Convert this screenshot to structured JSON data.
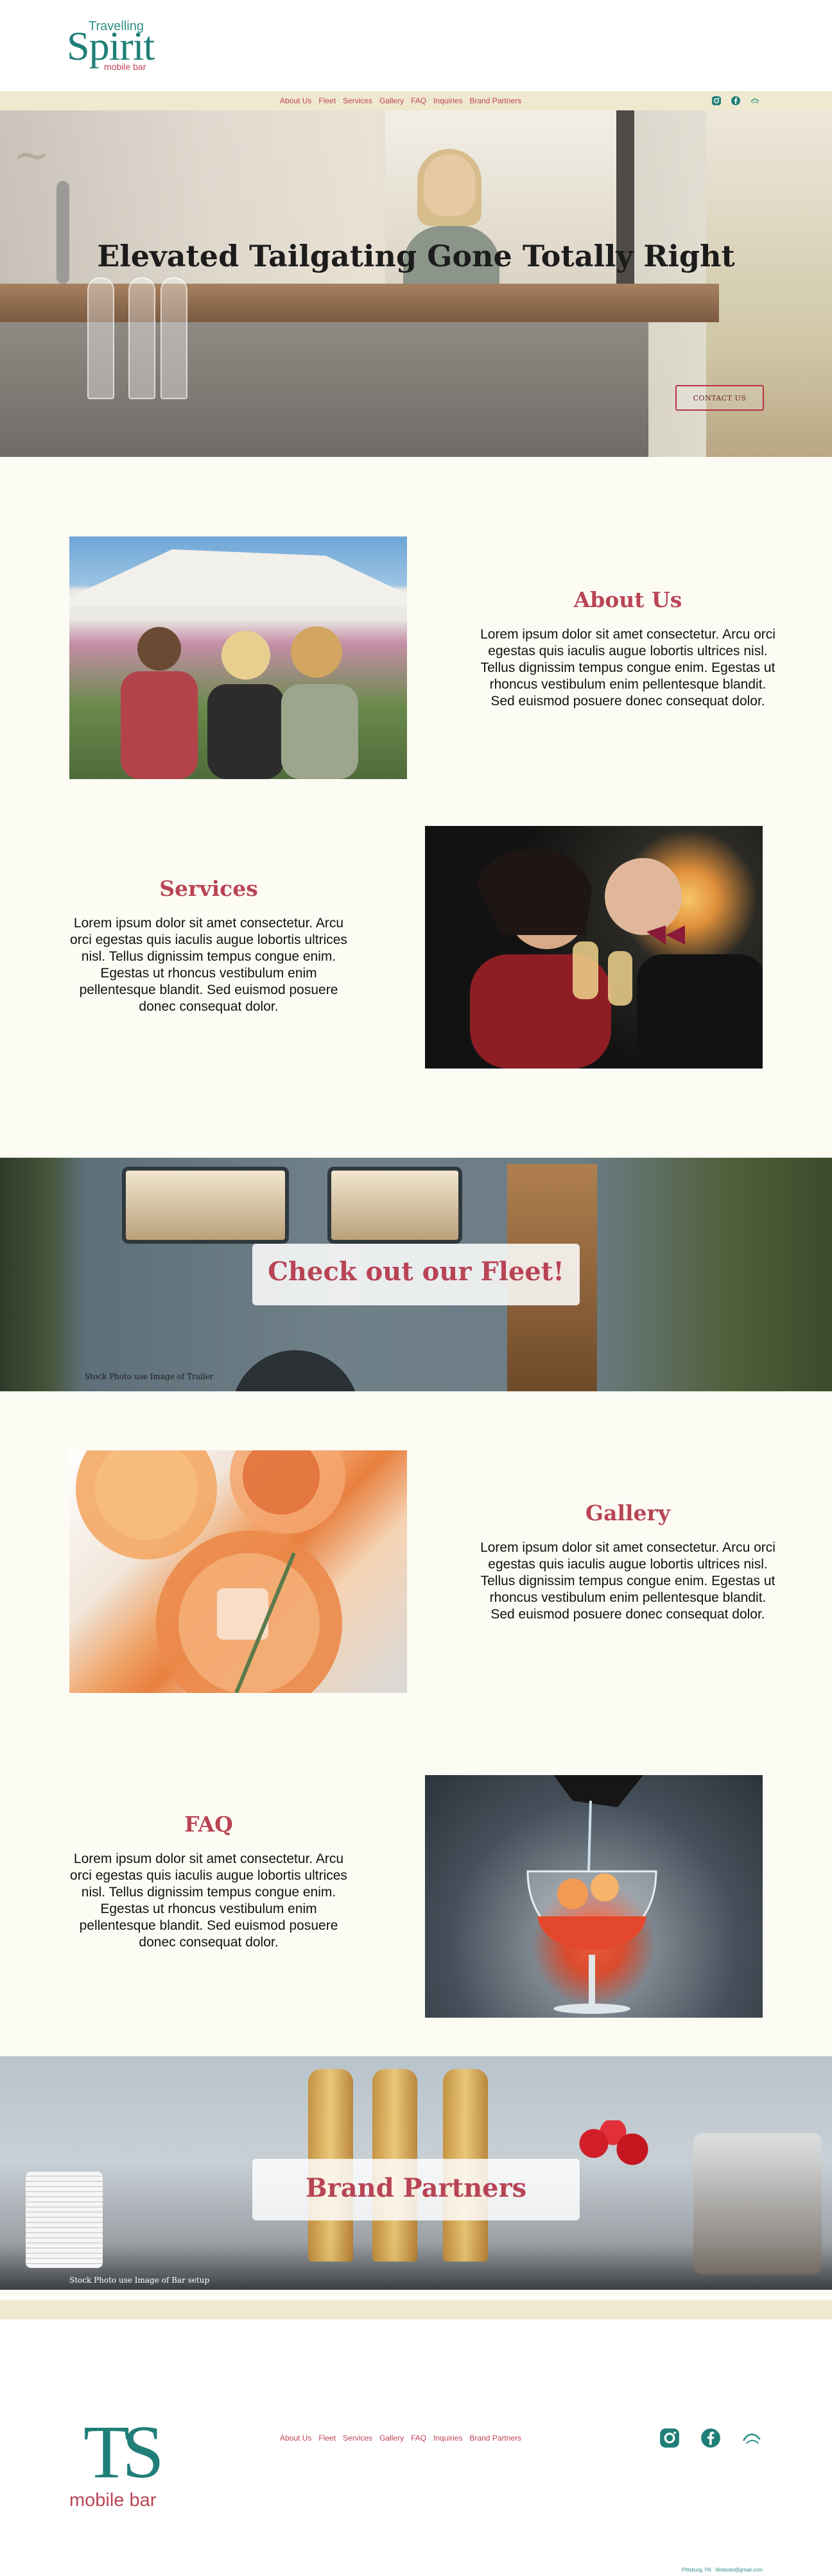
{
  "brand": {
    "line1": "Travelling",
    "line2": "Spirit",
    "line3": "mobile bar",
    "accent": "#b84455",
    "teal": "#1f7f78",
    "band": "#efe9cf"
  },
  "nav": {
    "items": [
      "About Us",
      "Fleet",
      "Services",
      "Gallery",
      "FAQ",
      "Inquiries",
      "Brand Partners"
    ],
    "social": [
      "instagram-icon",
      "facebook-icon",
      "spirit-logo-icon"
    ]
  },
  "hero": {
    "title": "Elevated Tailgating Gone Totally Right",
    "button": "CONTACT US"
  },
  "about": {
    "title": "About Us",
    "body": "Lorem ipsum dolor sit amet consectetur. Arcu orci egestas quis iaculis augue lobortis ultrices nisl. Tellus dignissim tempus congue enim. Egestas ut rhoncus vestibulum enim pellentesque blandit. Sed euismod posuere donec consequat dolor."
  },
  "services": {
    "title": "Services",
    "body": "Lorem ipsum dolor sit amet consectetur. Arcu orci egestas quis iaculis augue lobortis ultrices nisl. Tellus dignissim tempus congue enim. Egestas ut rhoncus vestibulum enim pellentesque blandit. Sed euismod posuere donec consequat dolor."
  },
  "fleet": {
    "title": "Check out our Fleet!",
    "caption": "Stock Photo use Image of Trailer"
  },
  "gallery": {
    "title": "Gallery",
    "body": "Lorem ipsum dolor sit amet consectetur. Arcu orci egestas quis iaculis augue lobortis ultrices nisl. Tellus dignissim tempus congue enim. Egestas ut rhoncus vestibulum enim pellentesque blandit. Sed euismod posuere donec consequat dolor."
  },
  "faq": {
    "title": "FAQ",
    "body": "Lorem ipsum dolor sit amet consectetur. Arcu orci egestas quis iaculis augue lobortis ultrices nisl. Tellus dignissim tempus congue enim. Egestas ut rhoncus vestibulum enim pellentesque blandit. Sed euismod posuere donec consequat dolor."
  },
  "partners": {
    "title": "Brand Partners",
    "caption": "Stock Photo use Image of Bar setup"
  },
  "footer": {
    "logo_mark": "TS",
    "logo_text": "mobile bar",
    "links": [
      "About Us",
      "Fleet",
      "Services",
      "Gallery",
      "FAQ",
      "Inquiries",
      "Brand Partners"
    ],
    "social": [
      "instagram-icon",
      "facebook-icon",
      "spirit-logo-icon"
    ],
    "contact": "Pittsburg, PA · Website@gmail.com"
  }
}
